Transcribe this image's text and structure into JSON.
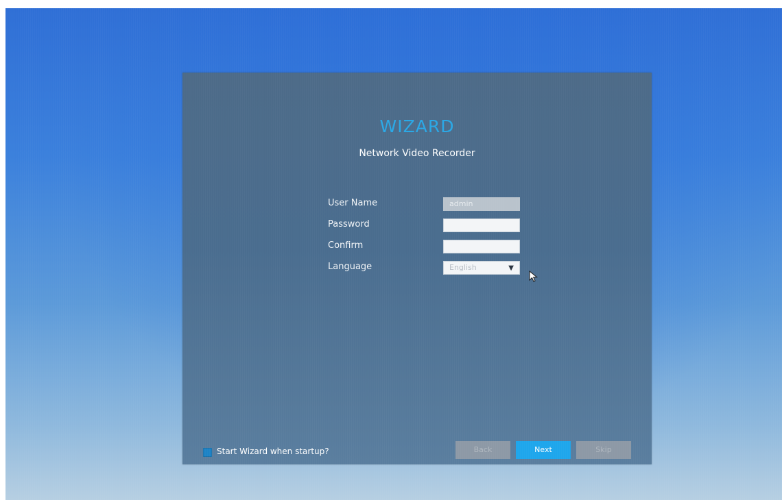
{
  "wizard": {
    "title": "WIZARD",
    "subtitle": "Network Video Recorder"
  },
  "form": {
    "username_label": "User Name",
    "username_value": "admin",
    "password_label": "Password",
    "password_value": "",
    "confirm_label": "Confirm",
    "confirm_value": "",
    "language_label": "Language",
    "language_value": "English"
  },
  "footer": {
    "startup_checkbox_label": "Start Wizard when startup?",
    "startup_checked": true,
    "back_label": "Back",
    "next_label": "Next",
    "skip_label": "Skip"
  },
  "colors": {
    "accent": "#1ea6ec",
    "title": "#2aa8e6",
    "panel": "#4a6d8f"
  },
  "icons": {
    "dropdown": "caret-down-icon",
    "pointer": "mouse-pointer-icon"
  }
}
